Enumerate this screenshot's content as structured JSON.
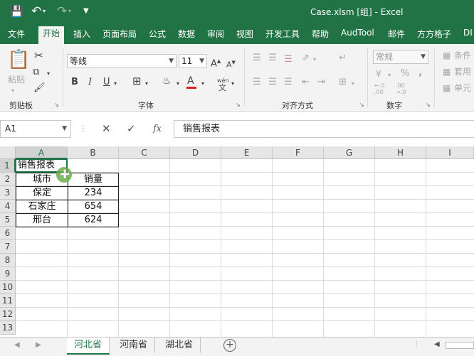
{
  "titlebar": {
    "title": "Case.xlsm  [组]  -  Excel",
    "save_icon": "save-icon",
    "undo_icon": "undo-icon",
    "redo_icon": "redo-icon",
    "customize_icon": "customize-quick-access-icon"
  },
  "ribbon_tabs": [
    "文件",
    "开始",
    "插入",
    "页面布局",
    "公式",
    "数据",
    "审阅",
    "视图",
    "开发工具",
    "帮助",
    "AudTool",
    "邮件",
    "方方格子",
    "DI"
  ],
  "active_tab": "开始",
  "ribbon": {
    "paste_label": "粘贴",
    "groups": {
      "clipboard": "剪贴板",
      "font": "字体",
      "alignment": "对齐方式",
      "number": "数字"
    },
    "font_name": "等线",
    "font_size": "11",
    "number_format": "常规",
    "bold": "B",
    "italic": "I",
    "underline": "U",
    "wen": "wén",
    "percent": "%",
    "comma": ",",
    "inc_decimal": "←.0 .00",
    "dec_decimal": ".00 →.0",
    "styles_items": [
      "条件",
      "套用",
      "单元"
    ]
  },
  "formula_bar": {
    "name_box": "A1",
    "fx": "fx",
    "content": "销售报表"
  },
  "grid": {
    "columns": [
      "A",
      "B",
      "C",
      "D",
      "E",
      "F",
      "G",
      "H",
      "I"
    ],
    "rows": [
      "1",
      "2",
      "3",
      "4",
      "5",
      "6",
      "7",
      "8",
      "9",
      "10",
      "11",
      "12",
      "13"
    ],
    "selected_cell": "A1",
    "cells": {
      "a1": "销售报表",
      "a2": "城市",
      "b2": "销量",
      "a3": "保定",
      "b3": "234",
      "a4": "石家庄",
      "b4": "654",
      "a5": "邢台",
      "b5": "624"
    }
  },
  "sheets": [
    "河北省",
    "河南省",
    "湖北省"
  ],
  "active_sheet": "河北省",
  "accent_color": "#217346"
}
